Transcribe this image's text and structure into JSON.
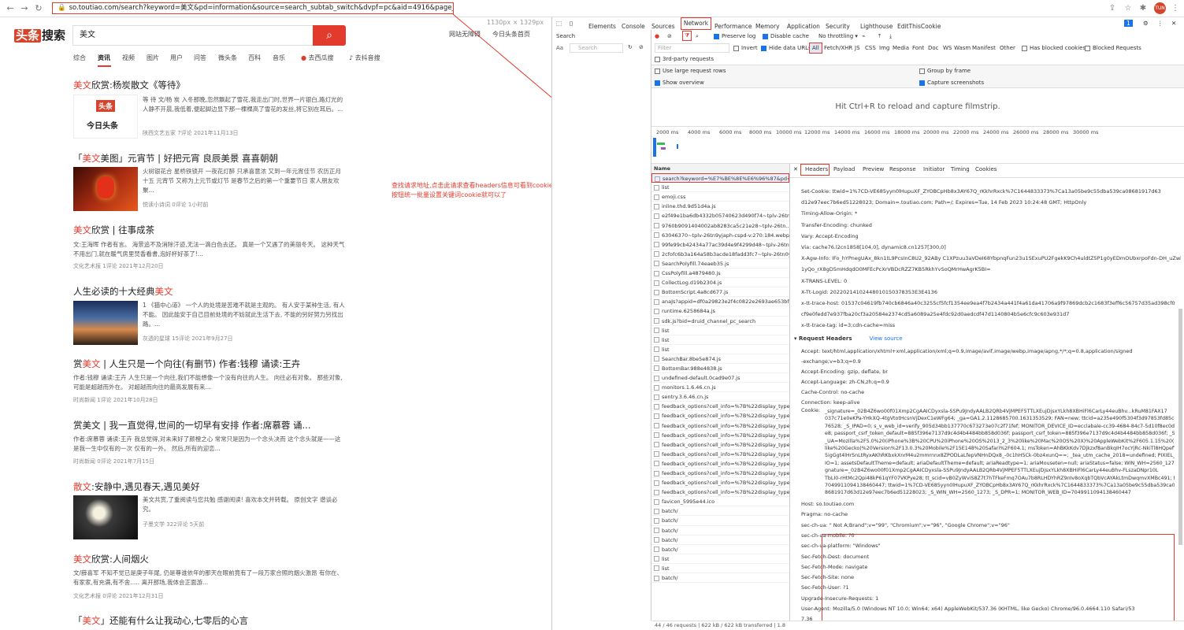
{
  "browser": {
    "url": "so.toutiao.com/search?keyword=美文&pd=information&source=search_subtab_switch&dvpf=pc&aid=4916&page_num=0",
    "avatar": "TUN"
  },
  "site": {
    "logo_a": "头条",
    "logo_b": "搜索",
    "query": "美文",
    "links": [
      "网站无障碍",
      "今日头条首页"
    ],
    "dims": "1130px × 1329px",
    "tabs": [
      "综合",
      "资讯",
      "视频",
      "图片",
      "用户",
      "问答",
      "微头条",
      "百科",
      "音乐",
      "去西瓜搜",
      "去抖音搜"
    ]
  },
  "results": [
    {
      "title_hl": "美文",
      "title": "欣赏:杨炭散文《等待》",
      "snip": "等 待 文/杨 炭 入冬那晚,忽然飘起了雪花,我走出门时,世界一片银白,路灯光的人静不开晨,我低着,便起脚边显下那一棵棵高了雪花的发丝,将它别在耳后。...",
      "meta": "陕西文艺五家  7评论  2021年11月13日"
    },
    {
      "title_pre": "「",
      "title_hl": "美文",
      "title": "美图」元宵节 | 好把元宵 良辰美景 喜喜朝朝",
      "snip": "火树银花合 星桥铁锁开 一夜花灯醉 只承喜意浓 又到一年元宵佳节 农历正月十五 元宵节 又称为上元节或灯节 是春节之后的第一个重要节日 家人朋友欢聚...",
      "meta": "悦读小诗词  0评论  1小时前"
    },
    {
      "title_hl": "美文",
      "title": "欣赏 | 往事成茶",
      "snip": "文:王海晖 作者有言。 海景追不及消除汗迹,无法一滴白色去还。 真是一个又遇了的美丽冬天。 这种天气不用出门,就在暖气房里焚香看書,泡好杯好茶了!...",
      "meta": "文化艺术报  1评论  2021年12月20日"
    },
    {
      "title": "人生必读的十大经典",
      "title_hl": "美文",
      "hl_after": true,
      "snip": "1 《猫中心道》 一个人的处境是苦难不就是主观的。 有人安于某种生活, 有人不能。 因此能安于自己目前处境的不妨就此生活下去, 不能的另好努力另找出路。...",
      "meta": "灰透的星球  15评论  2021年9月27日"
    },
    {
      "title_pre": "赏",
      "title_hl": "美文",
      "title": " | 人生只是一个向往(有删节) 作者:钱穆 诵读:王卉",
      "snip": "作者:钱穆 诵读:王卉 人生只是一个向往,我们不能想像一个没有向往的人生。 向往必有对象。 那些对象,可能是超越而外在。 对超越而向往的最高发展有来...",
      "meta": "时尚新闻  1评论  2021年10月28日"
    },
    {
      "title": "赏美文 | 我一直觉得,世间的一切早有安排 作者:席慕蓉 诵...",
      "snip": "作者:席慕蓉 诵读:王卉 我总觉得,对未来好了颜橙之心 常常只是因为一个念头决而 这个念头就是——这是我一生中仅有的一次 仅有的一外。 然后,所有的迎恋...",
      "meta": "时尚新闻  0评论  2021年7月15日"
    },
    {
      "title_hl": "散文",
      "title": ":安静中,遇见春天,遇见美好",
      "snip": "美文共赏,了重阅读与您共勉 感谢阅读! 喜欢本文并转载。 原创文字 谱谈必究。",
      "meta": "子墨文学  322评论  5天前"
    },
    {
      "title_hl": "美文",
      "title": "欣赏:人间烟火",
      "snip": "文/薛喜军 不知不觉已是庚子年尾, 仍是尊谁依年的那天在眼前竟有了一段万家合照的烟火激昂 有你在、有家家,有充满,有不舍..... 离开那场,我体会正面游...",
      "meta": "文化艺术报  0评论  2021年12月31日"
    },
    {
      "title_pre": "「",
      "title_hl": "美文",
      "title": "」还能有什么让我动心,七零后的心言",
      "snip": "",
      "meta": ""
    }
  ],
  "annotation": "查找请求地址,点击此请求查看headers信息可看到cookie,复制到采集关键词或者设置cookie按钮统一批量设置关键词cookie就可以了",
  "devtools": {
    "tabs": [
      "Elements",
      "Console",
      "Sources",
      "Network",
      "Performance",
      "Memory",
      "Application",
      "Security",
      "Lighthouse",
      "EditThisCookie"
    ],
    "search_label": "Search",
    "search_placeholder": "Search",
    "preserve_log": "Preserve log",
    "disable_cache": "Disable cache",
    "throttling": "No throttling",
    "filter_placeholder": "Filter",
    "invert": "Invert",
    "hide_data_urls": "Hide data URLs",
    "types": [
      "All",
      "Fetch/XHR",
      "JS",
      "CSS",
      "Img",
      "Media",
      "Font",
      "Doc",
      "WS",
      "Wasm",
      "Manifest",
      "Other"
    ],
    "has_blocked": "Has blocked cookies",
    "blocked_requests": "Blocked Requests",
    "third_party": "3rd-party requests",
    "use_large": "Use large request rows",
    "group_frame": "Group by frame",
    "show_overview": "Show overview",
    "capture_screens": "Capture screenshots",
    "filmstrip": "Hit Ctrl+R to reload and capture filmstrip.",
    "ticks": [
      "2000 ms",
      "4000 ms",
      "6000 ms",
      "8000 ms",
      "10000 ms",
      "12000 ms",
      "14000 ms",
      "16000 ms",
      "18000 ms",
      "20000 ms",
      "22000 ms",
      "24000 ms",
      "26000 ms",
      "28000 ms",
      "30000 ms"
    ],
    "name_header": "Name",
    "requests": [
      "search?keyword=%E7%BE%8E%E6%96%87&pd=...",
      "list",
      "emoji.css",
      "inline.thd.9d51d4a.js",
      "e2f49e1ba6db4332b05740623d490f74~tplv-26tn...",
      "9760b9091404002ab8283ca5c21e28~tplv-26tn...",
      "63046370~tplv-26tn9yjaph-cspd-v:270:184.webp",
      "99fe99cb42434a77ac39d4e9f4299d48~tplv-26tn...",
      "2cfofc6b3a164a58b3acde18fadd3fc7~tplv-26tn0y...",
      "SearchPolyfill.74eaeb35.js",
      "CssPolyfill.a4879480.js",
      "CollectLog.d19b2304.js",
      "BottomScript.4a8cd677.js",
      "anaJs?appid=df0a29823e2f4c0822e2693ae653bf...",
      "runtime.6258684a.js",
      "sdk.js?bid=druid_channel_pc_search",
      "list",
      "list",
      "list",
      "SearchBar.8be5e874.js",
      "BottomBar.988e4838.js",
      "undefined-default.0cad9e07.js",
      "monitors.1.6.46.cn.js",
      "sentry.3.6.46.cn.js",
      "feedback_options?cell_info=%7B%22display_type...",
      "feedback_options?cell_info=%7B%22display_type...",
      "feedback_options?cell_info=%7B%22display_type...",
      "feedback_options?cell_info=%7B%22display_type...",
      "feedback_options?cell_info=%7B%22display_type...",
      "feedback_options?cell_info=%7B%22display_type...",
      "feedback_options?cell_info=%7B%22display_type...",
      "feedback_options?cell_info=%7B%22display_type...",
      "feedback_options?cell_info=%7B%22display_type...",
      "feedback_options?cell_info=%7B%22display_type...",
      "favicon_5995e44.ico",
      "batch/",
      "batch/",
      "batch/",
      "batch/",
      "batch/",
      "list",
      "list",
      "batch/"
    ],
    "status": "44 / 46 requests  |  622 kB / 622 kB transferred  |  1.8",
    "detail_tabs": [
      "Headers",
      "Payload",
      "Preview",
      "Response",
      "Initiator",
      "Timing",
      "Cookies"
    ],
    "response_headers": [
      "Set-Cookie: ttwid=1%7CD-VE685yyn0lHupuXF_ZYOBCpHb8x3AY67Q_rKkhrRxck%7C1644833373%7Ca13a05be9c55dba539ca08681917d63",
      "d12e97eec7b6ed51228023; Domain=.toutiao.com; Path=/; Expires=Tue, 14 Feb 2023 10:24:48 GMT; HttpOnly",
      "Timing-Allow-Origin: *",
      "Transfer-Encoding: chunked",
      "Vary: Accept-Encoding",
      "Via: cache76.l2cn1858[104,0], dynamic8.cn1257[300,0]",
      "X-Agw-Info: IFo_hYPnegUAx_8kn1tL9PcsInC8U2_92ABy C1XPzuu3aVDeI68YbpnqFun23u1SExuPU2FgekK9Ch4uldtZ5P1g0yEDmOUbxrpoFdn-DH_uZwb",
      "1yQo_rX8gD5mHdqdO0MFEcPcXrVBDcRZZ7KB5RkhYvSoQMrHwAgrK5BI=",
      "X-TRANS-LEVEL: 0",
      "X-Tt-Logid: 20220214102448010150378353E3E4136",
      "x-tt-trace-host: 01537c04619fb740cb6846a40c3255cf5fcf1354ee9ea4f7b2434a441f4a61da41706a9f97869dcb2c1683f3eff6c56757d35ad398cf0",
      "cf9e0fedd7e937fba20cf3a20584e2374cd5a6089a25e4fdc92d0aedcdf47d1140804b5e6cfc9c603e931d7",
      "x-tt-trace-tag: id=3;cdn-cache=miss"
    ],
    "request_title": "▾ Request Headers",
    "view_source": "View source",
    "request_headers": [
      "Accept: text/html,application/xhtml+xml,application/xml;q=0.9,image/avif,image/webp,image/apng,*/*;q=0.8,application/signed",
      "-exchange;v=b3;q=0.9",
      "Accept-Encoding: gzip, deflate, br",
      "Accept-Language: zh-CN,zh;q=0.9",
      "Cache-Control: no-cache",
      "Connection: keep-alive"
    ],
    "cookie_label": "Cookie:",
    "cookie_lines": [
      "_signature=_02B4Z6wo00f01Xmp2CgAAICDyxsla-SSPu9JndyAALB2QRb4VjMPEF5TTLXEujDjsxYLkh8XBHiFl6CarLy44euBhv...kRuM81FAX17",
      "037c71e0eKPa-YHkXQ-4tgVtotHcsnVjDexC1eWFg64; _ga=GA1.2.1128685700.1631353529; FAN=new; ttcid=a235e490f5304f3d97853fd85ce70",
      "76528; _S_IPAD=0; s_v_web_id=verify_905d34bb137770c673273e07c2f71fef; MONITOR_DEVICE_ID=ecclabale-cc39-4684-84c7-5d10f8ec0d",
      "e8; passport_csrf_token_default=885f396e7137d9c4d4b4484bb858d036f; passport_csrf_token=885f396e7137d9c4d4b4484bb858d036f; _S",
      "_UA=Mozilla%2F5.0%20(iPhone%3B%20CPU%20iPhone%20OS%2013_2_3%20like%20Mac%20OS%20X)%20AppleWebKit%2F605.1.15%20(KHTML%2C%20",
      "like%20Gecko)%20Version%2F13.0.3%20Mobile%2F15E148%20Safari%2F604.1; msToken=AhBKkKdv7Djkzxf8anBkqIH7ocYjRc-NkiTl8HQpefYtv",
      "5igGgt4lHrSnLtRyxAKhRKbxkXnrM4u2mmrnnx8ZPODLaLfepVNHnDQx8_-0c1hH5Ck-0bz4xunQ==; _tea_utm_cache_2018=undefined; PIXIEL_RAT",
      "IO=1; assetsDefaultTheme=default; ariaDefaultTheme=default; ariaReadtype=1; ariaMouseten=null; ariaStatus=false; WIN_WH=2560_1273; _si",
      "gnature=_02B4Z6wo00f01Xmp2CgAAICDyxsla-SSPu9JndyAALB2QRb4VjMPEF5TTLXEujDjsxYLkh8XBHiFl6CarLy44euBhv-FLszaDNpr10L",
      "TbLI0-rHtMc2Qpi48kP61qYF07VKPye28; tt_scid=vB0ZyWviS8Z7t7hTFkeFmq7OAu7b8RLHDYhRZ9nIv8oXqbTQbVcAYAkLtmDwqmvXMBc491; tt_webid=",
      "7049911094138460447; ttwid=1%7CD-VE685yyn0lHupuXF_ZYOBCpHb8x3AY67Q_rKkhrRxck%7C1644833373%7Ca13a05be9c55dba539ca08",
      "8681917d63d12e97eec7b6ed51228023; _S_WIN_WH=2560_1273; _S_DPR=1; MONITOR_WEB_ID=7049911094138460447"
    ],
    "after_cookie": [
      "Host: so.toutiao.com",
      "Pragma: no-cache",
      "sec-ch-ua: \" Not A;Brand\";v=\"99\", \"Chromium\";v=\"96\", \"Google Chrome\";v=\"96\"",
      "sec-ch-ua-mobile: ?0",
      "sec-ch-ua-platform: \"Windows\"",
      "Sec-Fetch-Dest: document",
      "Sec-Fetch-Mode: navigate",
      "Sec-Fetch-Site: none",
      "Sec-Fetch-User: ?1",
      "Upgrade-Insecure-Requests: 1",
      "User-Agent: Mozilla/5.0 (Windows NT 10.0; Win64; x64) AppleWebKit/537.36 (KHTML, like Gecko) Chrome/96.0.4664.110 Safari/53",
      "7.36"
    ]
  }
}
